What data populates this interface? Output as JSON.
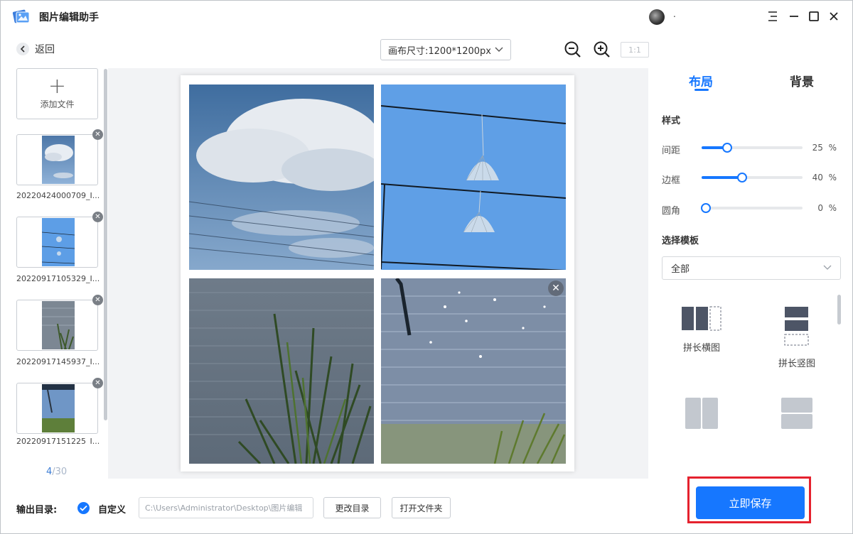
{
  "app": {
    "title": "图片编辑助手",
    "user_name": "."
  },
  "toolbar": {
    "back_label": "返回",
    "canvas_size": "画布尺寸:1200*1200px",
    "ratio_label": "1:1"
  },
  "left": {
    "add_label": "添加文件",
    "files": [
      {
        "name": "20220424000709_I...",
        "icon": "photo-thumbnail"
      },
      {
        "name": "20220917105329_I...",
        "icon": "photo-thumbnail"
      },
      {
        "name": "20220917145937_I...",
        "icon": "photo-thumbnail"
      },
      {
        "name": "20220917151225_I...",
        "icon": "photo-thumbnail"
      }
    ],
    "page_current": "4",
    "page_total": "/30"
  },
  "right": {
    "tabs": [
      "布局",
      "背景"
    ],
    "active_tab": "布局",
    "style_title": "样式",
    "sliders": [
      {
        "label": "间距",
        "value": "25",
        "unit": "%",
        "fraction": 0.25
      },
      {
        "label": "边框",
        "value": "40",
        "unit": "%",
        "fraction": 0.4
      },
      {
        "label": "圆角",
        "value": "0",
        "unit": "%",
        "fraction": 0.0
      }
    ],
    "template_title": "选择模板",
    "template_selected": "全部",
    "templates": [
      "拼长横图",
      "拼长竖图"
    ]
  },
  "bottom": {
    "output_label": "输出目录:",
    "custom_label": "自定义",
    "path_value": "C:\\Users\\Administrator\\Desktop\\图片编辑",
    "change_dir": "更改目录",
    "open_folder": "打开文件夹",
    "save_label": "立即保存"
  },
  "colors": {
    "accent": "#1677ff",
    "highlight_border": "#e5222e"
  }
}
